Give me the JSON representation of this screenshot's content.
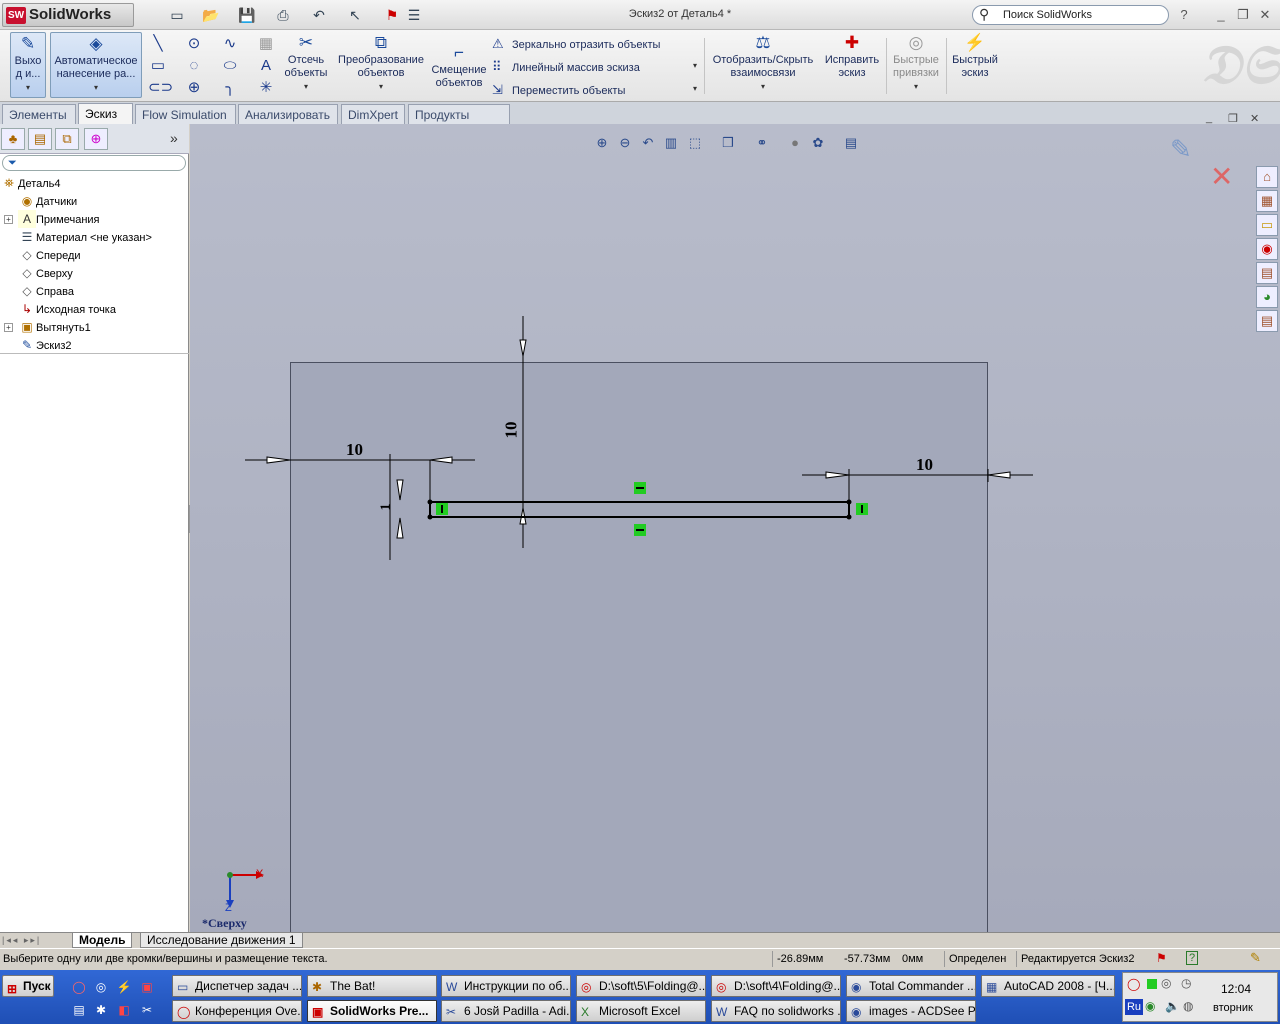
{
  "app": {
    "name": "SolidWorks",
    "doc_title": "Эскиз2 от Деталь4 *",
    "search_placeholder": "Поиск SolidWorks",
    "help": "?"
  },
  "ribbon": {
    "exit": "Выхо д и...",
    "autodim": "Автоматическое нанесение ра...",
    "trim": "Отсечь объекты",
    "convert": "Преобразование объектов",
    "offset": "Смещение объектов",
    "mirror": "Зеркально отразить объекты",
    "linear": "Линейный массив эскиза",
    "move": "Переместить объекты",
    "relations": "Отобразить/Скрыть взаимосвязи",
    "repair": "Исправить эскиз",
    "quicksnaps": "Быстрые привязки",
    "rapid": "Быстрый эскиз"
  },
  "tabs": [
    "Элементы",
    "Эскиз",
    "Flow Simulation",
    "Анализировать",
    "DimXpert",
    "Продукты Office"
  ],
  "active_tab": "Эскиз",
  "tree": [
    {
      "label": "Деталь4",
      "icon": "part-icon"
    },
    {
      "label": "Датчики",
      "icon": "sensor-icon"
    },
    {
      "label": "Примечания",
      "icon": "annotations-icon"
    },
    {
      "label": "Материал <не указан>",
      "icon": "material-icon"
    },
    {
      "label": "Спереди",
      "icon": "plane-icon"
    },
    {
      "label": "Сверху",
      "icon": "plane-icon"
    },
    {
      "label": "Справа",
      "icon": "plane-icon"
    },
    {
      "label": "Исходная точка",
      "icon": "origin-icon"
    },
    {
      "label": "Вытянуть1",
      "icon": "extrude-icon"
    },
    {
      "label": "Эскиз2",
      "icon": "sketch-icon"
    }
  ],
  "viewport": {
    "dims": {
      "left": "10",
      "vertical": "10",
      "right": "10",
      "height": "1"
    },
    "view_label": "*Сверху",
    "axis_x": "X",
    "axis_z": "Z"
  },
  "bottom_tabs": [
    "Модель",
    "Исследование движения 1"
  ],
  "status": {
    "message": "Выберите одну или две кромки/вершины и размещение текста.",
    "x": "-26.89мм",
    "y": "-57.73мм",
    "z": "0мм",
    "state": "Определен",
    "editing": "Редактируется Эскиз2"
  },
  "taskbar": {
    "start": "Пуск",
    "row1": [
      "Диспетчер задач ...",
      "The Bat!",
      "Инструкции по об...",
      "D:\\soft\\5\\Folding@...",
      "D:\\soft\\4\\Folding@...",
      "Total Commander ...",
      "AutoCAD 2008 - [Ч..."
    ],
    "row2": [
      "Конференция Ove...",
      "SolidWorks Pre...",
      "6 Josй Padilla - Adi...",
      "Microsoft Excel",
      "FAQ по solidworks ...",
      "images - ACDSee P..."
    ],
    "time": "12:04",
    "day": "вторник",
    "lang": "Ru"
  }
}
